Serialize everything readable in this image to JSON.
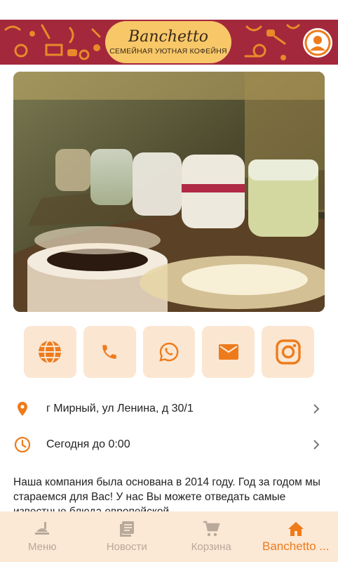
{
  "header": {
    "logo_title": "Banchetto",
    "logo_subtitle": "СЕМЕЙНАЯ УЮТНАЯ КОФЕЙНЯ"
  },
  "actions": [
    {
      "icon": "globe-icon"
    },
    {
      "icon": "phone-icon"
    },
    {
      "icon": "whatsapp-icon"
    },
    {
      "icon": "mail-icon"
    },
    {
      "icon": "instagram-icon"
    }
  ],
  "info": {
    "address": "г Мирный, ул Ленина, д 30/1",
    "hours": "Сегодня до 0:00"
  },
  "about": {
    "text": "Наша компания была основана в 2014 году. Год за годом мы стараемся для Вас! У нас Вы можете отведать самые известные блюда европейской"
  },
  "nav": {
    "items": [
      {
        "label": "Меню"
      },
      {
        "label": "Новости"
      },
      {
        "label": "Корзина"
      },
      {
        "label": "Banchetto ..."
      }
    ]
  },
  "colors": {
    "accent": "#ee7b1b",
    "banner": "#a3283c",
    "logo_pill": "#f7c768",
    "button_bg": "#fbe6d2",
    "nav_bg": "#fbe8d5"
  }
}
